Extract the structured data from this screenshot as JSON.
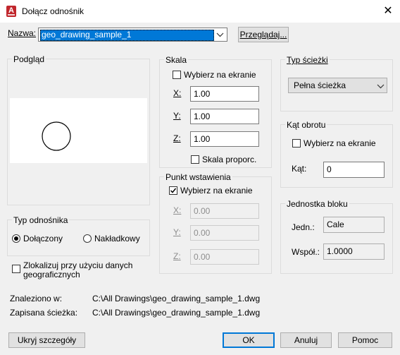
{
  "window": {
    "title": "Dołącz odnośnik",
    "app_icon": "A",
    "close_glyph": "✕"
  },
  "name": {
    "label": "Nazwa:",
    "value": "geo_drawing_sample_1",
    "browse_label": "Przeglądaj..."
  },
  "preview": {
    "title": "Podgląd"
  },
  "scale": {
    "title": "Skala",
    "pick_label": "Wybierz na ekranie",
    "x_label": "X:",
    "x": "1.00",
    "y_label": "Y:",
    "y": "1.00",
    "z_label": "Z:",
    "z": "1.00",
    "uniform_label": "Skala proporc."
  },
  "insertion": {
    "title": "Punkt wstawienia",
    "pick_label": "Wybierz na ekranie",
    "x_label": "X:",
    "x": "0.00",
    "y_label": "Y:",
    "y": "0.00",
    "z_label": "Z:",
    "z": "0.00"
  },
  "path_type": {
    "title": "Typ ścieżki",
    "value": "Pełna ścieżka"
  },
  "rotation": {
    "title": "Kąt obrotu",
    "pick_label": "Wybierz na ekranie",
    "angle_label": "Kąt:",
    "angle": "0"
  },
  "block_unit": {
    "title": "Jednostka bloku",
    "unit_label": "Jedn.:",
    "unit": "Cale",
    "factor_label": "Współ.:",
    "factor": "1.0000"
  },
  "ref_type": {
    "title": "Typ odnośnika",
    "attached": "Dołączony",
    "overlay": "Nakładkowy"
  },
  "geo": {
    "label_line1": "Zlokalizuj przy użyciu danych",
    "label_line2": "geograficznych"
  },
  "found": {
    "label": "Znaleziono w:",
    "path": "C:\\All Drawings\\geo_drawing_sample_1.dwg"
  },
  "saved": {
    "label": "Zapisana ścieżka:",
    "path": "C:\\All Drawings\\geo_drawing_sample_1.dwg"
  },
  "buttons": {
    "hide_details": "Ukryj szczegóły",
    "ok": "OK",
    "cancel": "Anuluj",
    "help": "Pomoc"
  }
}
